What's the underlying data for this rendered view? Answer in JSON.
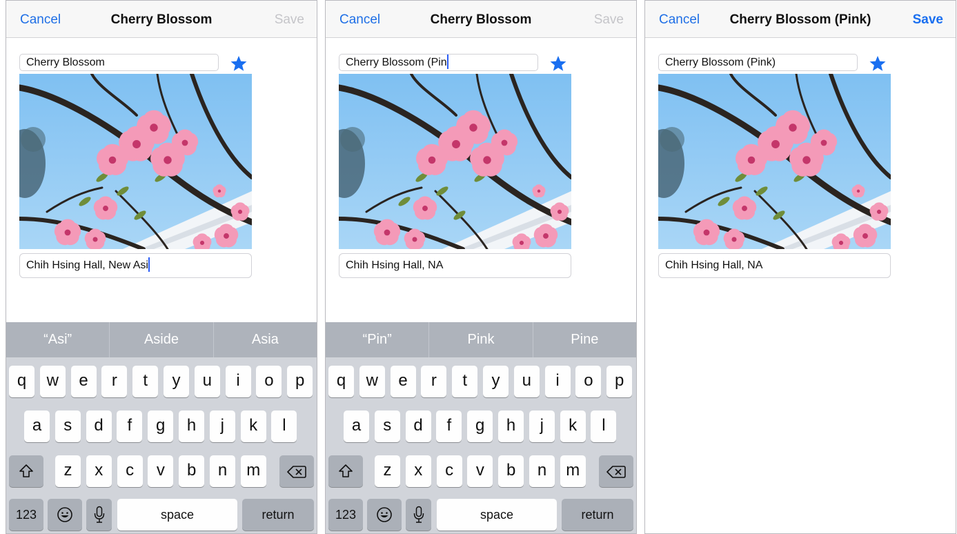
{
  "screens": [
    {
      "nav": {
        "cancel": "Cancel",
        "title": "Cherry Blossom",
        "save": "Save",
        "save_enabled": false
      },
      "name_value": "Cherry Blossom",
      "name_caret": false,
      "location_value": "Chih Hsing Hall, New Asi",
      "location_caret": true,
      "suggestions": [
        "“Asi”",
        "Aside",
        "Asia"
      ],
      "keyboard": true
    },
    {
      "nav": {
        "cancel": "Cancel",
        "title": "Cherry Blossom",
        "save": "Save",
        "save_enabled": false
      },
      "name_value": "Cherry Blossom (Pin",
      "name_caret": true,
      "location_value": "Chih Hsing Hall, NA",
      "location_caret": false,
      "suggestions": [
        "“Pin”",
        "Pink",
        "Pine"
      ],
      "keyboard": true
    },
    {
      "nav": {
        "cancel": "Cancel",
        "title": "Cherry Blossom (Pink)",
        "save": "Save",
        "save_enabled": true
      },
      "name_value": "Cherry Blossom (Pink)",
      "name_caret": false,
      "location_value": "Chih Hsing Hall, NA",
      "location_caret": false,
      "suggestions": [],
      "keyboard": false
    }
  ],
  "keys": {
    "row1": [
      "q",
      "w",
      "e",
      "r",
      "t",
      "y",
      "u",
      "i",
      "o",
      "p"
    ],
    "row2": [
      "a",
      "s",
      "d",
      "f",
      "g",
      "h",
      "j",
      "k",
      "l"
    ],
    "row3": [
      "z",
      "x",
      "c",
      "v",
      "b",
      "n",
      "m"
    ],
    "numbers": "123",
    "space": "space",
    "return": "return"
  },
  "colors": {
    "accent": "#1f6fe6",
    "star": "#1a6ff0",
    "disabled": "#c5c5c9",
    "keyboard_bg": "#d1d4da",
    "suggestion_bar": "#aeb3bb"
  },
  "icons": {
    "favorite": "star-icon",
    "shift": "shift-icon",
    "delete": "backspace-icon",
    "emoji": "emoji-icon",
    "dictation": "microphone-icon"
  }
}
